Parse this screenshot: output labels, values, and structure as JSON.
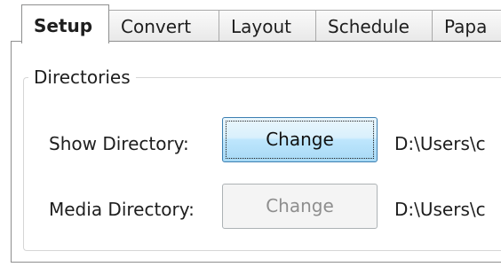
{
  "tabs": [
    {
      "label": "Setup",
      "active": true
    },
    {
      "label": "Convert",
      "active": false
    },
    {
      "label": "Layout",
      "active": false
    },
    {
      "label": "Schedule",
      "active": false
    },
    {
      "label": "Papa",
      "active": false
    }
  ],
  "directories": {
    "group_title": "Directories",
    "show": {
      "label": "Show Directory:",
      "button": "Change",
      "path": "D:\\Users\\c"
    },
    "media": {
      "label": "Media Directory:",
      "button": "Change",
      "path": "D:\\Users\\c"
    }
  },
  "colors": {
    "focused_button_border": "#3c7fb1",
    "disabled_text": "#8e8e8e"
  }
}
